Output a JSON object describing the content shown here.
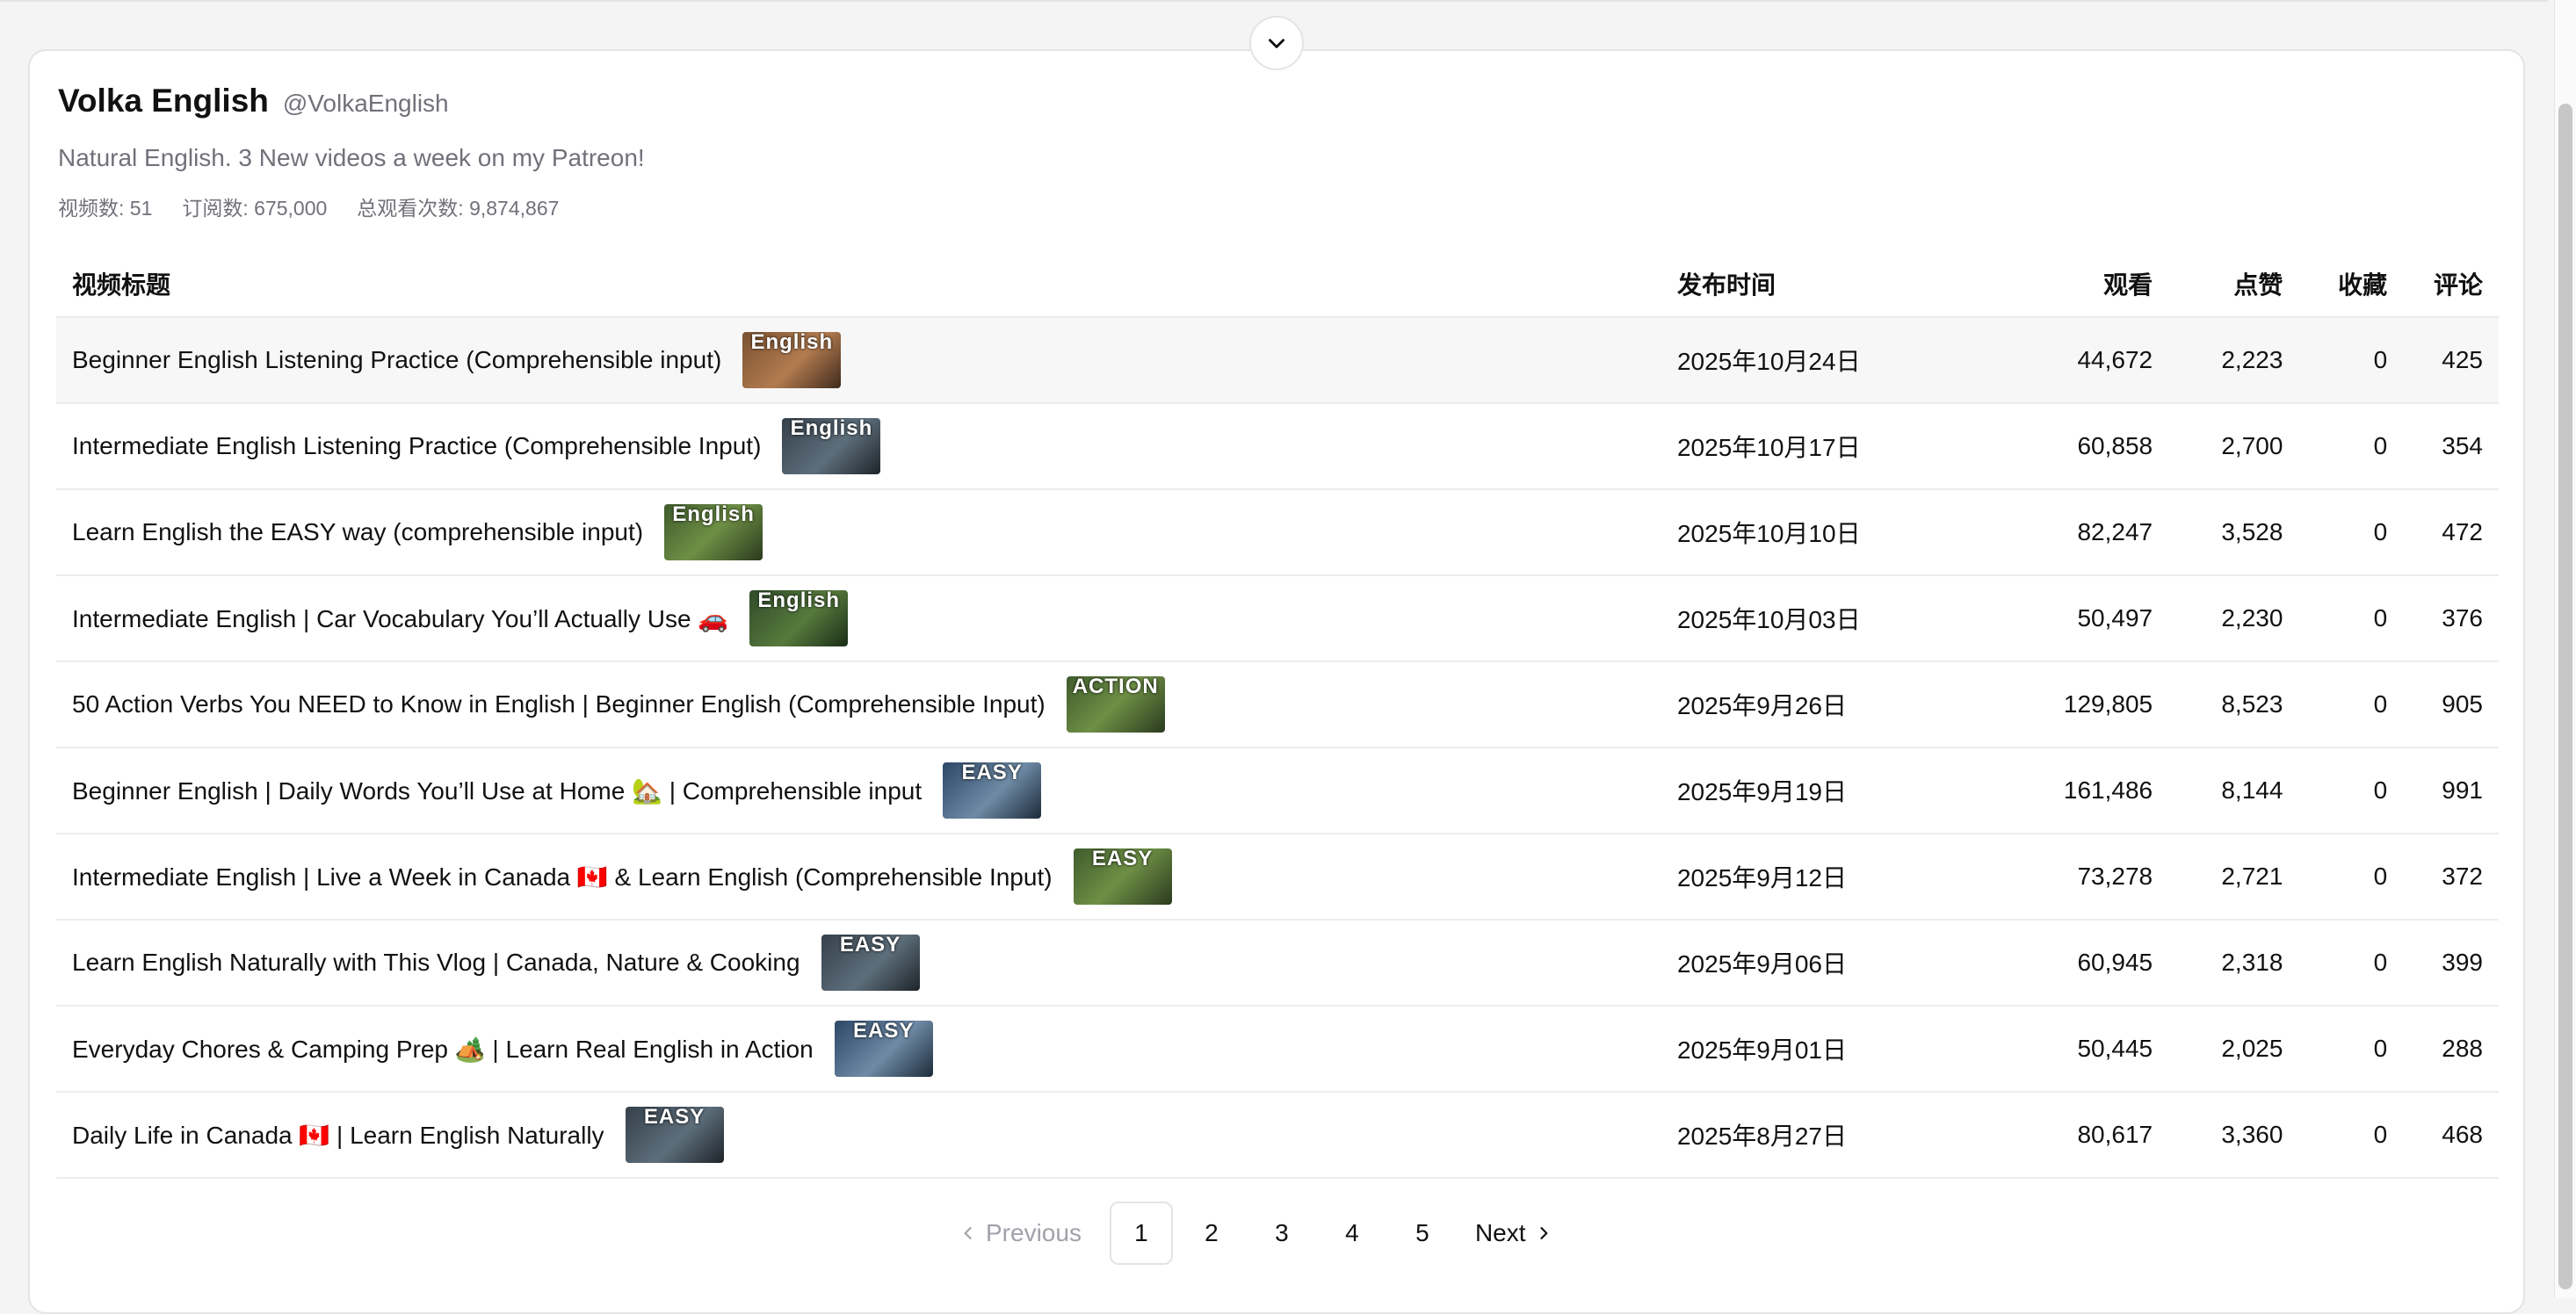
{
  "channel": {
    "name": "Volka English",
    "handle": "@VolkaEnglish",
    "description": "Natural English. 3 New videos a week on my Patreon!",
    "stats": {
      "videos": "视频数: 51",
      "subscribers": "订阅数: 675,000",
      "total_views": "总观看次数: 9,874,867"
    }
  },
  "table": {
    "headers": {
      "title": "视频标题",
      "date": "发布时间",
      "views": "观看",
      "likes": "点赞",
      "favorites": "收藏",
      "comments": "评论"
    },
    "rows": [
      {
        "title": "Beginner English Listening Practice (Comprehensible input)",
        "thumb_text": "English",
        "thumb_color": "#8a5a36",
        "date": "2025年10月24日",
        "views": "44,672",
        "likes": "2,223",
        "favorites": "0",
        "comments": "425"
      },
      {
        "title": "Intermediate English Listening Practice (Comprehensible Input)",
        "thumb_text": "English",
        "thumb_color": "#566372",
        "date": "2025年10月17日",
        "views": "60,858",
        "likes": "2,700",
        "favorites": "0",
        "comments": "354"
      },
      {
        "title": "Learn English the EASY way (comprehensible input)",
        "thumb_text": "English",
        "thumb_color": "#3f5b2d",
        "date": "2025年10月10日",
        "views": "82,247",
        "likes": "3,528",
        "favorites": "0",
        "comments": "472"
      },
      {
        "title": "Intermediate English | Car Vocabulary You’ll Actually Use 🚗",
        "thumb_text": "English",
        "thumb_color": "#2f4b2a",
        "date": "2025年10月03日",
        "views": "50,497",
        "likes": "2,230",
        "favorites": "0",
        "comments": "376"
      },
      {
        "title": "50 Action Verbs You NEED to Know in English | Beginner English (Comprehensible Input)",
        "thumb_text": "ACTION",
        "thumb_color": "#3f5b2d",
        "date": "2025年9月26日",
        "views": "129,805",
        "likes": "8,523",
        "favorites": "0",
        "comments": "905"
      },
      {
        "title": "Beginner English | Daily Words You’ll Use at Home 🏡 | Comprehensible input",
        "thumb_text": "EASY",
        "thumb_color": "#2d4766",
        "date": "2025年9月19日",
        "views": "161,486",
        "likes": "8,144",
        "favorites": "0",
        "comments": "991"
      },
      {
        "title": "Intermediate English | Live a Week in Canada 🇨🇦 & Learn English (Comprehensible Input)",
        "thumb_text": "EASY",
        "thumb_color": "#3f5b2d",
        "date": "2025年9月12日",
        "views": "73,278",
        "likes": "2,721",
        "favorites": "0",
        "comments": "372"
      },
      {
        "title": "Learn English Naturally with This Vlog | Canada, Nature & Cooking",
        "thumb_text": "EASY",
        "thumb_color": "#35404a",
        "date": "2025年9月06日",
        "views": "60,945",
        "likes": "2,318",
        "favorites": "0",
        "comments": "399"
      },
      {
        "title": "Everyday Chores & Camping Prep 🏕️ | Learn Real English in Action",
        "thumb_text": "EASY",
        "thumb_color": "#2d4766",
        "date": "2025年9月01日",
        "views": "50,445",
        "likes": "2,025",
        "favorites": "0",
        "comments": "288"
      },
      {
        "title": "Daily Life in Canada 🇨🇦 | Learn English Naturally",
        "thumb_text": "EASY",
        "thumb_color": "#35404a",
        "date": "2025年8月27日",
        "views": "80,617",
        "likes": "3,360",
        "favorites": "0",
        "comments": "468"
      }
    ]
  },
  "pagination": {
    "previous": "Previous",
    "next": "Next",
    "pages": [
      "1",
      "2",
      "3",
      "4",
      "5"
    ],
    "current": "1"
  }
}
